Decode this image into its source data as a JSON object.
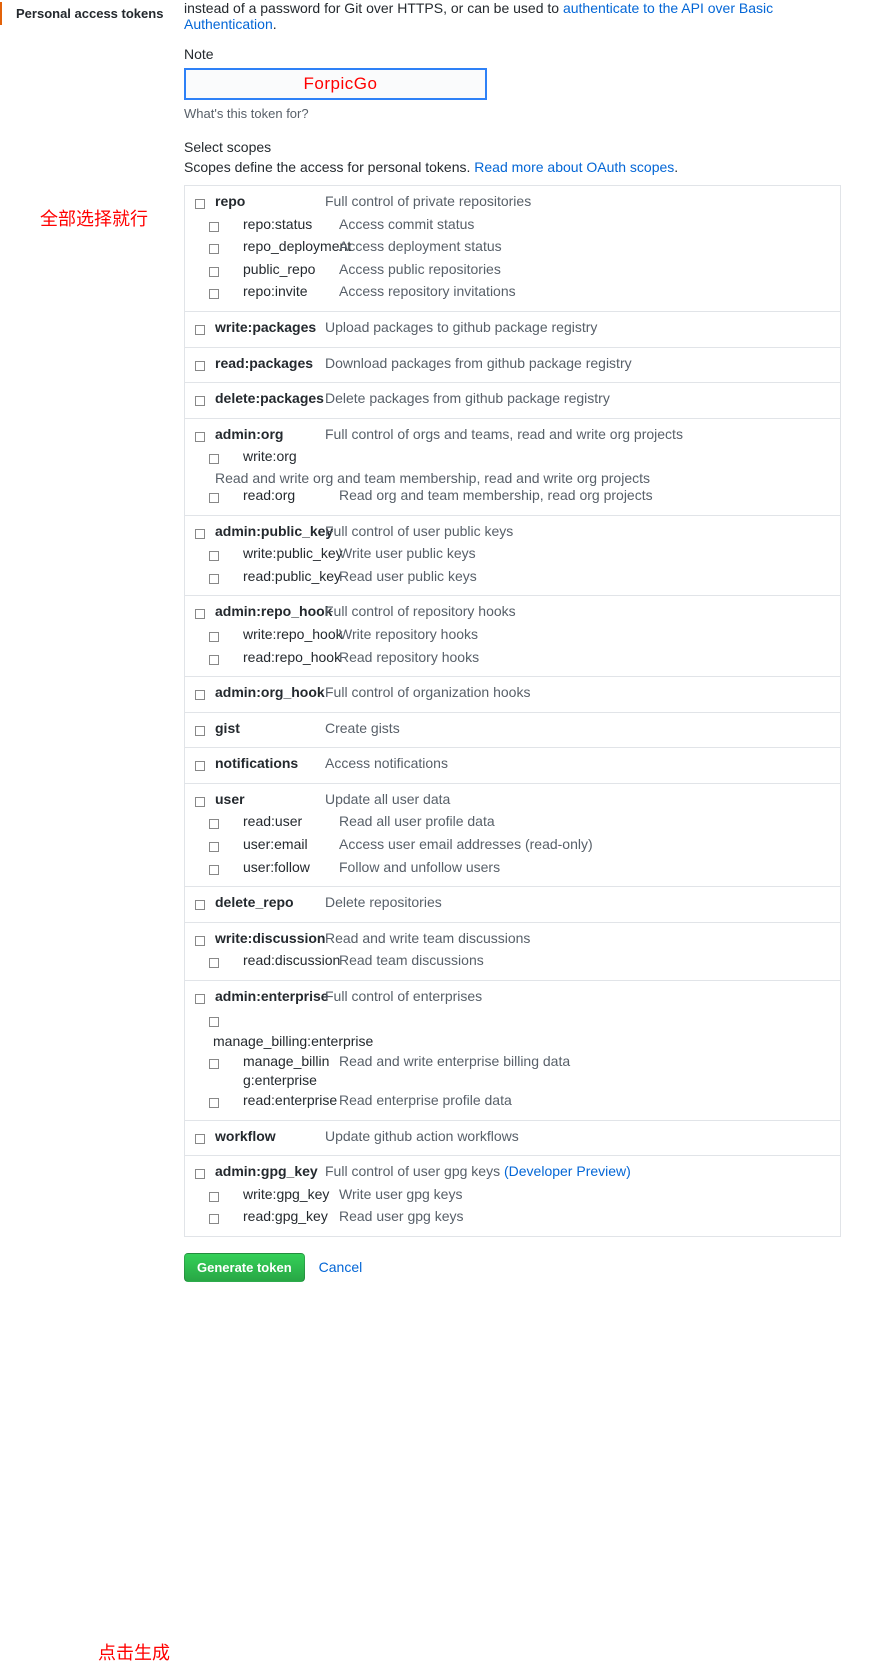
{
  "sidebar": {
    "active_item": "Personal access tokens"
  },
  "annotations": {
    "select_all": "全部选择就行",
    "click_generate": "点击生成"
  },
  "intro": {
    "line1_prefix": "instead of a password for Git over HTTPS, or can be used to ",
    "link1": "authenticate to the API over Basic Authentication",
    "period": "."
  },
  "note": {
    "label": "Note",
    "value": "ForpicGo",
    "helper": "What's this token for?"
  },
  "scopes": {
    "title": "Select scopes",
    "desc_prefix": "Scopes define the access for personal tokens. ",
    "desc_link": "Read more about OAuth scopes",
    "desc_period": "."
  },
  "groups": [
    {
      "name": "repo",
      "desc": "Full control of private repositories",
      "children": [
        {
          "name": "repo:status",
          "desc": "Access commit status"
        },
        {
          "name": "repo_deployment",
          "desc": "Access deployment status"
        },
        {
          "name": "public_repo",
          "desc": "Access public repositories"
        },
        {
          "name": "repo:invite",
          "desc": "Access repository invitations"
        }
      ]
    },
    {
      "name": "write:packages",
      "desc": "Upload packages to github package registry",
      "children": []
    },
    {
      "name": "read:packages",
      "desc": "Download packages from github package registry",
      "children": []
    },
    {
      "name": "delete:packages",
      "desc": "Delete packages from github package registry",
      "children": []
    },
    {
      "name": "admin:org",
      "desc": "Full control of orgs and teams, read and write org projects",
      "wrap_after_first_child": "Read and write org and team membership, read and write org projects",
      "children": [
        {
          "name": "write:org",
          "desc": ""
        },
        {
          "name": "read:org",
          "desc": "Read org and team membership, read org projects"
        }
      ]
    },
    {
      "name": "admin:public_key",
      "desc": "Full control of user public keys",
      "children": [
        {
          "name": "write:public_key",
          "desc": "Write user public keys"
        },
        {
          "name": "read:public_key",
          "desc": "Read user public keys"
        }
      ]
    },
    {
      "name": "admin:repo_hook",
      "desc": "Full control of repository hooks",
      "children": [
        {
          "name": "write:repo_hook",
          "desc": "Write repository hooks"
        },
        {
          "name": "read:repo_hook",
          "desc": "Read repository hooks"
        }
      ]
    },
    {
      "name": "admin:org_hook",
      "desc": "Full control of organization hooks",
      "children": []
    },
    {
      "name": "gist",
      "desc": "Create gists",
      "children": []
    },
    {
      "name": "notifications",
      "desc": "Access notifications",
      "children": []
    },
    {
      "name": "user",
      "desc": "Update all user data",
      "children": [
        {
          "name": "read:user",
          "desc": "Read all user profile data"
        },
        {
          "name": "user:email",
          "desc": "Access user email addresses (read-only)"
        },
        {
          "name": "user:follow",
          "desc": "Follow and unfollow users"
        }
      ]
    },
    {
      "name": "delete_repo",
      "desc": "Delete repositories",
      "children": []
    },
    {
      "name": "write:discussion",
      "desc": "Read and write team discussions",
      "children": [
        {
          "name": "read:discussion",
          "desc": "Read team discussions"
        }
      ]
    },
    {
      "name": "admin:enterprise",
      "desc": "Full control of enterprises",
      "children": [
        {
          "name": "manage_billing:enterprise",
          "desc": "Read and write enterprise billing data",
          "wide_name": true
        },
        {
          "name": "read:enterprise",
          "desc": "Read enterprise profile data"
        }
      ]
    },
    {
      "name": "workflow",
      "desc": "Update github action workflows",
      "children": []
    },
    {
      "name": "admin:gpg_key",
      "desc": "Full control of user gpg keys ",
      "desc_link": "(Developer Preview)",
      "children": [
        {
          "name": "write:gpg_key",
          "desc": "Write user gpg keys"
        },
        {
          "name": "read:gpg_key",
          "desc": "Read user gpg keys"
        }
      ]
    }
  ],
  "actions": {
    "generate": "Generate token",
    "cancel": "Cancel"
  }
}
